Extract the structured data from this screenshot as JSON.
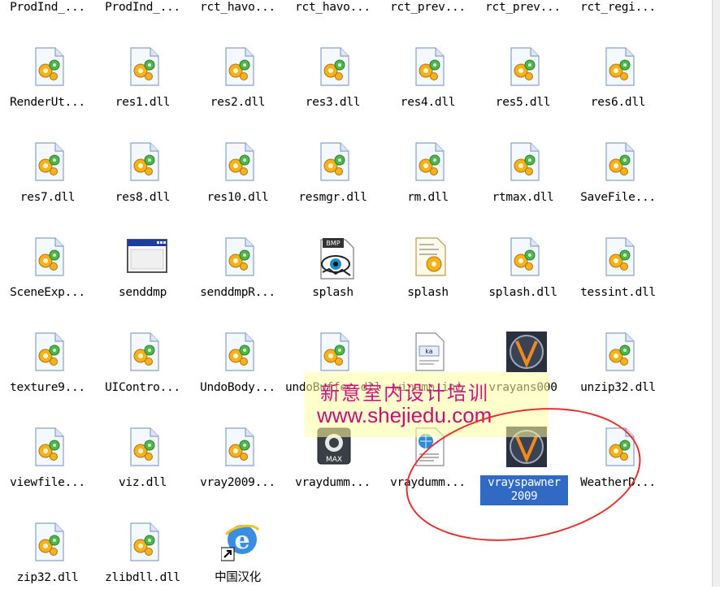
{
  "files": [
    {
      "label": "ProdInd_...",
      "icon": "none"
    },
    {
      "label": "ProdInd_...",
      "icon": "none"
    },
    {
      "label": "rct_havo...",
      "icon": "none"
    },
    {
      "label": "rct_havo...",
      "icon": "none"
    },
    {
      "label": "rct_prev...",
      "icon": "none"
    },
    {
      "label": "rct_prev...",
      "icon": "none"
    },
    {
      "label": "rct_regi...",
      "icon": "none"
    },
    {
      "label": "RenderUt...",
      "icon": "dll-file-icon"
    },
    {
      "label": "res1.dll",
      "icon": "dll-file-icon"
    },
    {
      "label": "res2.dll",
      "icon": "dll-file-icon"
    },
    {
      "label": "res3.dll",
      "icon": "dll-file-icon"
    },
    {
      "label": "res4.dll",
      "icon": "dll-file-icon"
    },
    {
      "label": "res5.dll",
      "icon": "dll-file-icon"
    },
    {
      "label": "res6.dll",
      "icon": "dll-file-icon"
    },
    {
      "label": "res7.dll",
      "icon": "dll-file-icon"
    },
    {
      "label": "res8.dll",
      "icon": "dll-file-icon"
    },
    {
      "label": "res10.dll",
      "icon": "dll-file-icon"
    },
    {
      "label": "resmgr.dll",
      "icon": "dll-file-icon"
    },
    {
      "label": "rm.dll",
      "icon": "dll-file-icon"
    },
    {
      "label": "rtmax.dll",
      "icon": "dll-file-icon"
    },
    {
      "label": "SaveFile...",
      "icon": "dll-file-icon"
    },
    {
      "label": "SceneExp...",
      "icon": "dll-file-icon"
    },
    {
      "label": "senddmp",
      "icon": "application-window-icon"
    },
    {
      "label": "senddmpR...",
      "icon": "dll-file-icon"
    },
    {
      "label": "splash",
      "icon": "bmp-image-icon"
    },
    {
      "label": "splash",
      "icon": "ini-config-icon"
    },
    {
      "label": "splash.dll",
      "icon": "dll-file-icon"
    },
    {
      "label": "tessint.dll",
      "icon": "dll-file-icon"
    },
    {
      "label": "texture9...",
      "icon": "dll-file-icon"
    },
    {
      "label": "UIContro...",
      "icon": "dll-file-icon"
    },
    {
      "label": "UndoBody...",
      "icon": "dll-file-icon"
    },
    {
      "label": "undoBuffer.dll",
      "icon": "dll-file-icon"
    },
    {
      "label": "winamp.ini",
      "icon": "ini-settings-icon"
    },
    {
      "label": "vrayans000",
      "icon": "vray-app-icon"
    },
    {
      "label": "unzip32.dll",
      "icon": "dll-file-icon"
    },
    {
      "label": "viewfile...",
      "icon": "dll-file-icon"
    },
    {
      "label": "viz.dll",
      "icon": "dll-file-icon"
    },
    {
      "label": "vray2009...",
      "icon": "dll-file-icon"
    },
    {
      "label": "vraydumm...",
      "icon": "max-scene-icon"
    },
    {
      "label": "vraydumm...",
      "icon": "html-document-icon"
    },
    {
      "label": "vrayspawner 2009",
      "icon": "vray-app-icon",
      "selected": true
    },
    {
      "label": "WeatherD...",
      "icon": "dll-file-icon"
    },
    {
      "label": "zip32.dll",
      "icon": "dll-file-icon"
    },
    {
      "label": "zlibdll.dll",
      "icon": "dll-file-icon"
    },
    {
      "label": "中国汉化",
      "icon": "ie-shortcut-icon"
    }
  ],
  "watermark": {
    "line1": "新意室内设计培训",
    "line2": "www.shejiedu.com"
  },
  "colors": {
    "selection": "#316ac5",
    "watermark_text": "#cc1580",
    "highlight_circle": "#e53030"
  }
}
